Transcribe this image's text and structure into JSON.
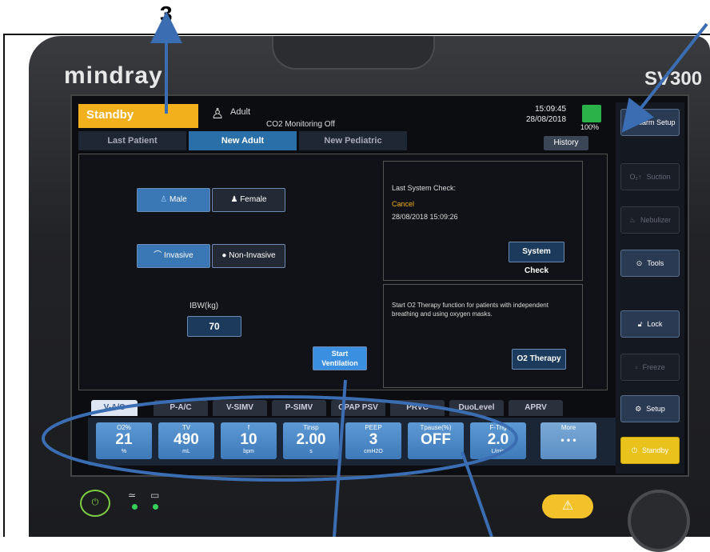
{
  "annotation": {
    "number": "3"
  },
  "device": {
    "brand": "mindray",
    "model": "SV300"
  },
  "status": {
    "mode": "Standby",
    "patient_type": "Adult",
    "co2": "CO2 Monitoring Off",
    "time": "15:09:45",
    "date": "28/08/2018",
    "battery": "100%"
  },
  "tabs": [
    "Last Patient",
    "New Adult",
    "New Pediatric"
  ],
  "history": "History",
  "gender": {
    "male": "Male",
    "female": "Female"
  },
  "interface": {
    "invasive": "Invasive",
    "noninvasive": "Non-Invasive"
  },
  "ibw": {
    "label": "IBW(kg)",
    "value": "70"
  },
  "start": {
    "line1": "Start",
    "line2": "Ventilation"
  },
  "system_check": {
    "title": "Last System Check:",
    "status": "Cancel",
    "datetime": "28/08/2018 15:09:26",
    "button": "System Check"
  },
  "o2": {
    "text": "Start O2 Therapy function for patients with independent breathing and using oxygen masks.",
    "button": "O2 Therapy"
  },
  "side": {
    "alarm": "Alarm Setup",
    "suction": "Suction",
    "nebulizer": "Nebulizer",
    "tools": "Tools",
    "lock": "Lock",
    "freeze": "Freeze",
    "setup": "Setup",
    "standby": "Standby"
  },
  "modes": [
    "V-A/C",
    "P-A/C",
    "V-SIMV",
    "P-SIMV",
    "CPAP PSV",
    "PRVC",
    "DuoLevel",
    "APRV"
  ],
  "params": [
    {
      "name": "O2%",
      "value": "21",
      "unit": "%"
    },
    {
      "name": "TV",
      "value": "490",
      "unit": "mL"
    },
    {
      "name": "f",
      "value": "10",
      "unit": "bpm"
    },
    {
      "name": "Tinsp",
      "value": "2.00",
      "unit": "s"
    },
    {
      "name": "PEEP",
      "value": "3",
      "unit": "cmH2O"
    },
    {
      "name": "Tpause(%)",
      "value": "OFF",
      "unit": ""
    },
    {
      "name": "F-Trig",
      "value": "2.0",
      "unit": "L/min"
    }
  ],
  "more": {
    "label": "More",
    "dots": "• • •"
  },
  "colors": {
    "annotation": "#3b6db3",
    "standby": "#f2b01c",
    "param": "#4a89c8"
  }
}
